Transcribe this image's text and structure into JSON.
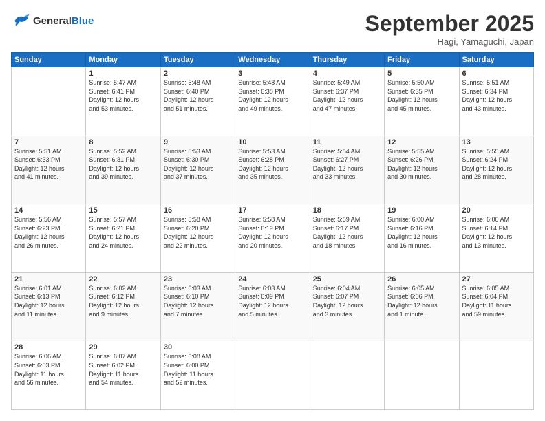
{
  "logo": {
    "line1": "General",
    "line2": "Blue"
  },
  "title": "September 2025",
  "location": "Hagi, Yamaguchi, Japan",
  "weekdays": [
    "Sunday",
    "Monday",
    "Tuesday",
    "Wednesday",
    "Thursday",
    "Friday",
    "Saturday"
  ],
  "weeks": [
    [
      {
        "day": "",
        "info": ""
      },
      {
        "day": "1",
        "info": "Sunrise: 5:47 AM\nSunset: 6:41 PM\nDaylight: 12 hours\nand 53 minutes."
      },
      {
        "day": "2",
        "info": "Sunrise: 5:48 AM\nSunset: 6:40 PM\nDaylight: 12 hours\nand 51 minutes."
      },
      {
        "day": "3",
        "info": "Sunrise: 5:48 AM\nSunset: 6:38 PM\nDaylight: 12 hours\nand 49 minutes."
      },
      {
        "day": "4",
        "info": "Sunrise: 5:49 AM\nSunset: 6:37 PM\nDaylight: 12 hours\nand 47 minutes."
      },
      {
        "day": "5",
        "info": "Sunrise: 5:50 AM\nSunset: 6:35 PM\nDaylight: 12 hours\nand 45 minutes."
      },
      {
        "day": "6",
        "info": "Sunrise: 5:51 AM\nSunset: 6:34 PM\nDaylight: 12 hours\nand 43 minutes."
      }
    ],
    [
      {
        "day": "7",
        "info": "Sunrise: 5:51 AM\nSunset: 6:33 PM\nDaylight: 12 hours\nand 41 minutes."
      },
      {
        "day": "8",
        "info": "Sunrise: 5:52 AM\nSunset: 6:31 PM\nDaylight: 12 hours\nand 39 minutes."
      },
      {
        "day": "9",
        "info": "Sunrise: 5:53 AM\nSunset: 6:30 PM\nDaylight: 12 hours\nand 37 minutes."
      },
      {
        "day": "10",
        "info": "Sunrise: 5:53 AM\nSunset: 6:28 PM\nDaylight: 12 hours\nand 35 minutes."
      },
      {
        "day": "11",
        "info": "Sunrise: 5:54 AM\nSunset: 6:27 PM\nDaylight: 12 hours\nand 33 minutes."
      },
      {
        "day": "12",
        "info": "Sunrise: 5:55 AM\nSunset: 6:26 PM\nDaylight: 12 hours\nand 30 minutes."
      },
      {
        "day": "13",
        "info": "Sunrise: 5:55 AM\nSunset: 6:24 PM\nDaylight: 12 hours\nand 28 minutes."
      }
    ],
    [
      {
        "day": "14",
        "info": "Sunrise: 5:56 AM\nSunset: 6:23 PM\nDaylight: 12 hours\nand 26 minutes."
      },
      {
        "day": "15",
        "info": "Sunrise: 5:57 AM\nSunset: 6:21 PM\nDaylight: 12 hours\nand 24 minutes."
      },
      {
        "day": "16",
        "info": "Sunrise: 5:58 AM\nSunset: 6:20 PM\nDaylight: 12 hours\nand 22 minutes."
      },
      {
        "day": "17",
        "info": "Sunrise: 5:58 AM\nSunset: 6:19 PM\nDaylight: 12 hours\nand 20 minutes."
      },
      {
        "day": "18",
        "info": "Sunrise: 5:59 AM\nSunset: 6:17 PM\nDaylight: 12 hours\nand 18 minutes."
      },
      {
        "day": "19",
        "info": "Sunrise: 6:00 AM\nSunset: 6:16 PM\nDaylight: 12 hours\nand 16 minutes."
      },
      {
        "day": "20",
        "info": "Sunrise: 6:00 AM\nSunset: 6:14 PM\nDaylight: 12 hours\nand 13 minutes."
      }
    ],
    [
      {
        "day": "21",
        "info": "Sunrise: 6:01 AM\nSunset: 6:13 PM\nDaylight: 12 hours\nand 11 minutes."
      },
      {
        "day": "22",
        "info": "Sunrise: 6:02 AM\nSunset: 6:12 PM\nDaylight: 12 hours\nand 9 minutes."
      },
      {
        "day": "23",
        "info": "Sunrise: 6:03 AM\nSunset: 6:10 PM\nDaylight: 12 hours\nand 7 minutes."
      },
      {
        "day": "24",
        "info": "Sunrise: 6:03 AM\nSunset: 6:09 PM\nDaylight: 12 hours\nand 5 minutes."
      },
      {
        "day": "25",
        "info": "Sunrise: 6:04 AM\nSunset: 6:07 PM\nDaylight: 12 hours\nand 3 minutes."
      },
      {
        "day": "26",
        "info": "Sunrise: 6:05 AM\nSunset: 6:06 PM\nDaylight: 12 hours\nand 1 minute."
      },
      {
        "day": "27",
        "info": "Sunrise: 6:05 AM\nSunset: 6:04 PM\nDaylight: 11 hours\nand 59 minutes."
      }
    ],
    [
      {
        "day": "28",
        "info": "Sunrise: 6:06 AM\nSunset: 6:03 PM\nDaylight: 11 hours\nand 56 minutes."
      },
      {
        "day": "29",
        "info": "Sunrise: 6:07 AM\nSunset: 6:02 PM\nDaylight: 11 hours\nand 54 minutes."
      },
      {
        "day": "30",
        "info": "Sunrise: 6:08 AM\nSunset: 6:00 PM\nDaylight: 11 hours\nand 52 minutes."
      },
      {
        "day": "",
        "info": ""
      },
      {
        "day": "",
        "info": ""
      },
      {
        "day": "",
        "info": ""
      },
      {
        "day": "",
        "info": ""
      }
    ]
  ]
}
